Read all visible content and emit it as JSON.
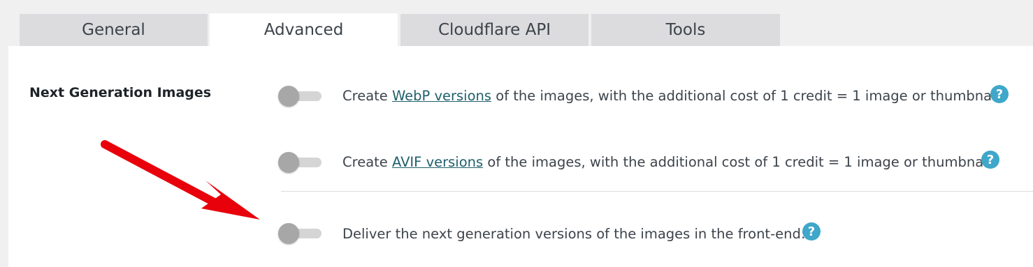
{
  "tabs": [
    {
      "label": "General",
      "active": false
    },
    {
      "label": "Advanced",
      "active": true
    },
    {
      "label": "Cloudflare API",
      "active": false
    },
    {
      "label": "Tools",
      "active": false
    }
  ],
  "section": {
    "title": "Next Generation Images"
  },
  "options": [
    {
      "prefix": "Create ",
      "link": "WebP versions",
      "suffix": " of the images, with the additional cost of 1 credit = 1 image or thumbnail.",
      "enabled": false,
      "help": "?"
    },
    {
      "prefix": "Create ",
      "link": "AVIF versions",
      "suffix": " of the images, with the additional cost of 1 credit = 1 image or thumbnail.",
      "enabled": false,
      "help": "?"
    },
    {
      "text": "Deliver the next generation versions of the images in the front-end:",
      "enabled": false,
      "help": "?"
    }
  ],
  "colors": {
    "background": "#f0f0f1",
    "tab_inactive": "#dcdcde",
    "panel": "#ffffff",
    "link": "#1f5f6b",
    "help_icon": "#3fa7c9",
    "annotation_arrow": "#e8000b"
  },
  "icons": {
    "help": "help-circle-icon",
    "annotation": "red-arrow-annotation"
  }
}
